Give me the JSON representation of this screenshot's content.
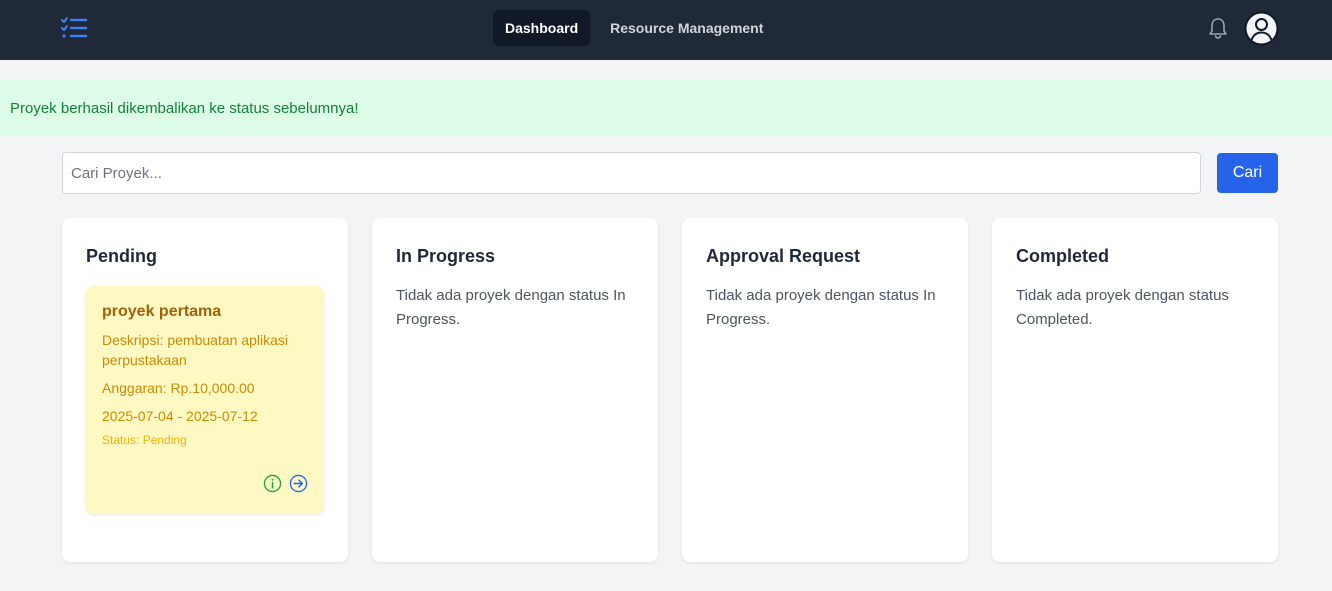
{
  "nav": {
    "logo_icon": "checklist-icon",
    "links": [
      {
        "label": "Dashboard",
        "active": true
      },
      {
        "label": "Resource Management",
        "active": false
      }
    ],
    "notification_icon": "bell-icon",
    "profile_icon": "user-circle-icon"
  },
  "alert": {
    "message": "Proyek berhasil dikembalikan ke status sebelumnya!"
  },
  "search": {
    "placeholder": "Cari Proyek...",
    "value": "",
    "button_label": "Cari"
  },
  "columns": [
    {
      "title": "Pending",
      "cards": [
        {
          "name": "proyek pertama",
          "description": "Deskripsi: pembuatan aplikasi perpustakaan",
          "budget": "Anggaran: Rp.10,000.00",
          "dates": "2025-07-04 - 2025-07-12",
          "status": "Status: Pending"
        }
      ]
    },
    {
      "title": "In Progress",
      "empty": "Tidak ada proyek dengan status In Progress."
    },
    {
      "title": "Approval Request",
      "empty": "Tidak ada proyek dengan status In Progress."
    },
    {
      "title": "Completed",
      "empty": "Tidak ada proyek dengan status Completed."
    }
  ],
  "colors": {
    "navbar": "#1f2937",
    "accent": "#2563eb",
    "alert_bg": "#dcfce7",
    "alert_text": "#15803d",
    "card_bg": "#fef9c3"
  }
}
